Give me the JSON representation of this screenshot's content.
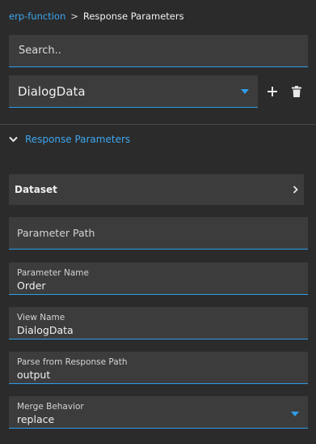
{
  "breadcrumb": {
    "parent": "erp-function",
    "separator": ">",
    "current": "Response Parameters"
  },
  "search": {
    "placeholder": "Search.."
  },
  "main_select": {
    "value": "DialogData",
    "add_icon": "plus-icon",
    "delete_icon": "trash-icon"
  },
  "section": {
    "title": "Response Parameters",
    "expand_icon": "chevron-down-icon"
  },
  "dataset": {
    "label": "Dataset",
    "icon": "chevron-right-icon"
  },
  "fields": {
    "parameter_path": {
      "placeholder": "Parameter Path"
    },
    "parameter_name": {
      "label": "Parameter Name",
      "value": "Order"
    },
    "view_name": {
      "label": "View Name",
      "value": "DialogData"
    },
    "parse_path": {
      "label": "Parse from Response Path",
      "value": "output"
    },
    "merge_behavior": {
      "label": "Merge Behavior",
      "value": "replace"
    }
  },
  "colors": {
    "background": "#2b2b2b",
    "field_bg": "#3c3c3c",
    "accent": "#2f9de8",
    "link": "#3ea6f0"
  }
}
